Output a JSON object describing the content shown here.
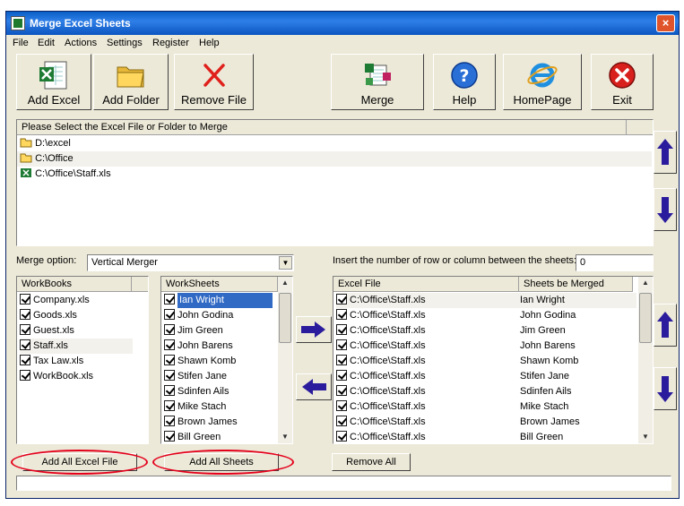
{
  "window": {
    "title": "Merge Excel Sheets",
    "close_glyph": "×"
  },
  "menu": [
    "File",
    "Edit",
    "Actions",
    "Settings",
    "Register",
    "Help"
  ],
  "toolbar": {
    "add_excel": "Add Excel",
    "add_folder": "Add Folder",
    "remove_file": "Remove File",
    "merge": "Merge",
    "help": "Help",
    "homepage": "HomePage",
    "exit": "Exit"
  },
  "file_list": {
    "header": "Please Select the Excel File or Folder to Merge",
    "items": [
      "D:\\excel",
      "C:\\Office",
      "C:\\Office\\Staff.xls"
    ]
  },
  "merge_option": {
    "label": "Merge option:",
    "value": "Vertical Merger"
  },
  "insert_rows": {
    "label": "Insert the number of row or column between the sheets:",
    "value": "0"
  },
  "workbooks": {
    "header": "WorkBooks",
    "items": [
      "Company.xls",
      "Goods.xls",
      "Guest.xls",
      "Staff.xls",
      "Tax Law.xls",
      "WorkBook.xls"
    ]
  },
  "worksheets": {
    "header": "WorkSheets",
    "items": [
      "Ian Wright",
      "John Godina",
      "Jim Green",
      "John Barens",
      "Shawn Komb",
      "Stifen Jane",
      "Sdinfen Ails",
      "Mike Stach",
      "Brown James",
      "Bill Green"
    ]
  },
  "merged": {
    "header_file": "Excel File",
    "header_sheet": "Sheets be Merged",
    "rows": [
      {
        "file": "C:\\Office\\Staff.xls",
        "sheet": "Ian Wright"
      },
      {
        "file": "C:\\Office\\Staff.xls",
        "sheet": "John Godina"
      },
      {
        "file": "C:\\Office\\Staff.xls",
        "sheet": "Jim Green"
      },
      {
        "file": "C:\\Office\\Staff.xls",
        "sheet": "John Barens"
      },
      {
        "file": "C:\\Office\\Staff.xls",
        "sheet": "Shawn Komb"
      },
      {
        "file": "C:\\Office\\Staff.xls",
        "sheet": "Stifen Jane"
      },
      {
        "file": "C:\\Office\\Staff.xls",
        "sheet": "Sdinfen Ails"
      },
      {
        "file": "C:\\Office\\Staff.xls",
        "sheet": "Mike Stach"
      },
      {
        "file": "C:\\Office\\Staff.xls",
        "sheet": "Brown James"
      },
      {
        "file": "C:\\Office\\Staff.xls",
        "sheet": "Bill Green"
      }
    ]
  },
  "buttons": {
    "add_all_excel": "Add All Excel File",
    "add_all_sheets": "Add All Sheets",
    "remove_all": "Remove All"
  },
  "colors": {
    "highlight": "#316ac5",
    "arrow": "#2a1c9c",
    "annotation": "#e4001b"
  }
}
